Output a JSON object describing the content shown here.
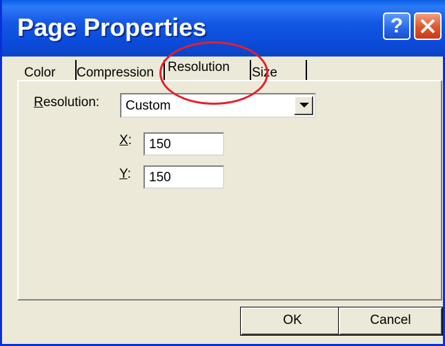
{
  "window": {
    "title": "Page Properties",
    "help_label": "?",
    "close_icon": "close-icon"
  },
  "tabs": [
    {
      "label": "Color",
      "selected": false
    },
    {
      "label": "Compression",
      "selected": false
    },
    {
      "label": "Resolution",
      "selected": true
    },
    {
      "label": "Size",
      "selected": false
    }
  ],
  "resolution": {
    "label_prefix": "",
    "label_accel": "R",
    "label_rest": "esolution:",
    "selected_value": "Custom",
    "x_label_accel": "X",
    "x_label_rest": ":",
    "x_value": "150",
    "y_label_accel": "Y",
    "y_label_rest": ":",
    "y_value": "150"
  },
  "buttons": {
    "ok_label": "OK",
    "cancel_label": "Cancel"
  },
  "colors": {
    "title_bar": "#0b4bd9",
    "dialog_background": "#ece9d8",
    "close_button": "#e0542a",
    "annotation_circle": "#e4202a"
  }
}
